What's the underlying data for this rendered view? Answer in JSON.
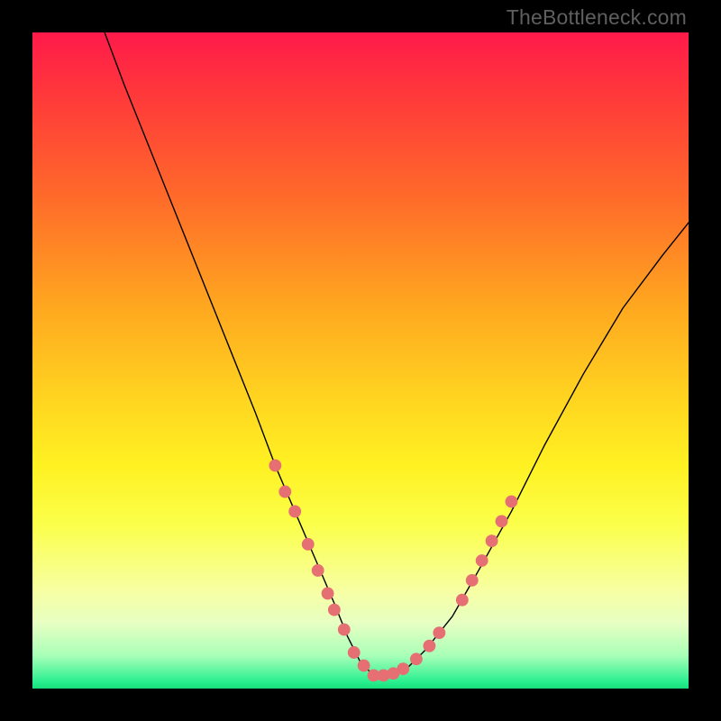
{
  "watermark": "TheBottleneck.com",
  "chart_data": {
    "type": "line",
    "title": "",
    "xlabel": "",
    "ylabel": "",
    "xlim": [
      0,
      100
    ],
    "ylim": [
      0,
      100
    ],
    "grid": false,
    "legend": false,
    "curve": {
      "name": "bottleneck-curve",
      "x": [
        11,
        14,
        18,
        22,
        26,
        30,
        34,
        37,
        40,
        43,
        46,
        48,
        50,
        52,
        54,
        57,
        60,
        64,
        68,
        73,
        78,
        84,
        90,
        96,
        100
      ],
      "y": [
        100,
        92,
        82,
        72,
        62,
        52,
        42,
        34,
        27,
        20,
        13,
        8,
        4,
        2,
        2,
        3,
        6,
        11,
        18,
        27,
        37,
        48,
        58,
        66,
        71
      ]
    },
    "markers": {
      "name": "highlight-dots",
      "color": "#e56f72",
      "points": [
        {
          "x": 37.0,
          "y": 34.0
        },
        {
          "x": 38.5,
          "y": 30.0
        },
        {
          "x": 40.0,
          "y": 27.0
        },
        {
          "x": 42.0,
          "y": 22.0
        },
        {
          "x": 43.5,
          "y": 18.0
        },
        {
          "x": 45.0,
          "y": 14.5
        },
        {
          "x": 46.0,
          "y": 12.0
        },
        {
          "x": 47.5,
          "y": 9.0
        },
        {
          "x": 49.0,
          "y": 5.5
        },
        {
          "x": 50.5,
          "y": 3.5
        },
        {
          "x": 52.0,
          "y": 2.0
        },
        {
          "x": 53.5,
          "y": 2.0
        },
        {
          "x": 55.0,
          "y": 2.3
        },
        {
          "x": 56.5,
          "y": 3.0
        },
        {
          "x": 58.5,
          "y": 4.5
        },
        {
          "x": 60.5,
          "y": 6.5
        },
        {
          "x": 62.0,
          "y": 8.5
        },
        {
          "x": 65.5,
          "y": 13.5
        },
        {
          "x": 67.0,
          "y": 16.5
        },
        {
          "x": 68.5,
          "y": 19.5
        },
        {
          "x": 70.0,
          "y": 22.5
        },
        {
          "x": 71.5,
          "y": 25.5
        },
        {
          "x": 73.0,
          "y": 28.5
        }
      ]
    },
    "gradient_stops": [
      {
        "pos": 0,
        "color": "#ff1a4a"
      },
      {
        "pos": 10,
        "color": "#ff3a3a"
      },
      {
        "pos": 25,
        "color": "#ff6a2a"
      },
      {
        "pos": 42,
        "color": "#ffa81f"
      },
      {
        "pos": 55,
        "color": "#ffd220"
      },
      {
        "pos": 66,
        "color": "#fff122"
      },
      {
        "pos": 75,
        "color": "#fbff4a"
      },
      {
        "pos": 85,
        "color": "#f7ffa2"
      },
      {
        "pos": 90,
        "color": "#e7ffc2"
      },
      {
        "pos": 95,
        "color": "#a8ffb8"
      },
      {
        "pos": 99,
        "color": "#28ef8f"
      },
      {
        "pos": 100,
        "color": "#18df7a"
      }
    ]
  }
}
